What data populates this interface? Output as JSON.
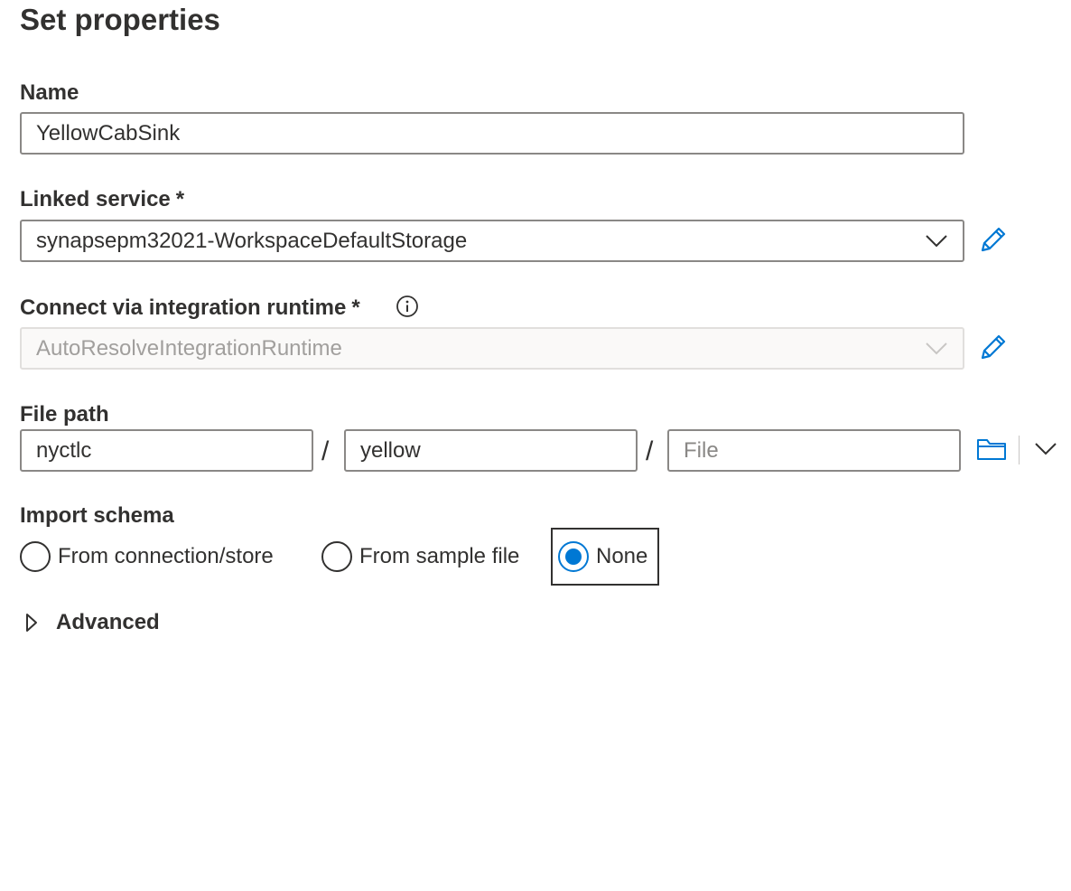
{
  "page": {
    "title": "Set properties"
  },
  "name_field": {
    "label": "Name",
    "value": "YellowCabSink"
  },
  "linked_service": {
    "label": "Linked service",
    "required_marker": "*",
    "value": "synapsepm32021-WorkspaceDefaultStorage",
    "edit_icon": "pencil-icon"
  },
  "integration_runtime": {
    "label": "Connect via integration runtime",
    "required_marker": "*",
    "info_icon": "info-icon",
    "value": "AutoResolveIntegrationRuntime",
    "disabled": true,
    "edit_icon": "pencil-icon"
  },
  "file_path": {
    "label": "File path",
    "container": "nyctlc",
    "directory": "yellow",
    "file_placeholder": "File",
    "separator": "/",
    "browse_icon": "folder-icon",
    "more_icon": "chevron-down-icon"
  },
  "import_schema": {
    "label": "Import schema",
    "options": [
      {
        "label": "From connection/store",
        "selected": false
      },
      {
        "label": "From sample file",
        "selected": false
      },
      {
        "label": "None",
        "selected": true
      }
    ]
  },
  "advanced": {
    "label": "Advanced",
    "expanded": false
  },
  "colors": {
    "accent": "#0078d4",
    "text": "#323130",
    "border": "#8a8886",
    "disabled_text": "#a19f9d"
  }
}
